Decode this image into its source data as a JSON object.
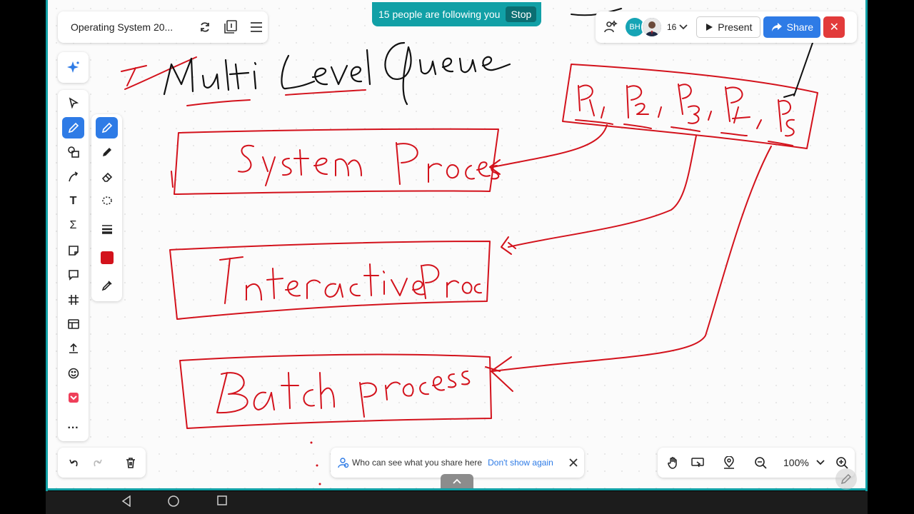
{
  "app": {
    "doc_title": "Operating System 20...",
    "follow_banner": "15 people are following you",
    "stop_label": "Stop",
    "avatar_initials": "BH",
    "user_count": "16",
    "present_label": "Present",
    "share_label": "Share"
  },
  "privacy": {
    "text": "Who can see what you share here",
    "dont_show": "Don't show again"
  },
  "zoom": {
    "level": "100%"
  },
  "colors": {
    "accent": "#2e7be6",
    "teal": "#11a0a6",
    "ink": "#d3121c",
    "close": "#e23b3b"
  },
  "icons": {
    "title_bar": [
      "sync-icon",
      "pages-icon",
      "menu-icon"
    ],
    "toolbar": [
      "select-icon",
      "pen-icon",
      "shapes-icon",
      "connector-icon",
      "text-icon",
      "equation-icon",
      "sticky-note-icon",
      "comment-icon",
      "frame-icon",
      "template-icon",
      "upload-icon",
      "emoji-icon",
      "pocket-icon",
      "more-icon"
    ],
    "pen_panel": [
      "pen-icon",
      "marker-icon",
      "eraser-icon",
      "lasso-icon",
      "stroke-width-icon",
      "color-swatch",
      "eyedropper-icon"
    ],
    "zoom_bar": [
      "hand-icon",
      "screen-share-icon",
      "map-pin-icon",
      "zoom-out-icon",
      "zoom-in-icon"
    ]
  }
}
